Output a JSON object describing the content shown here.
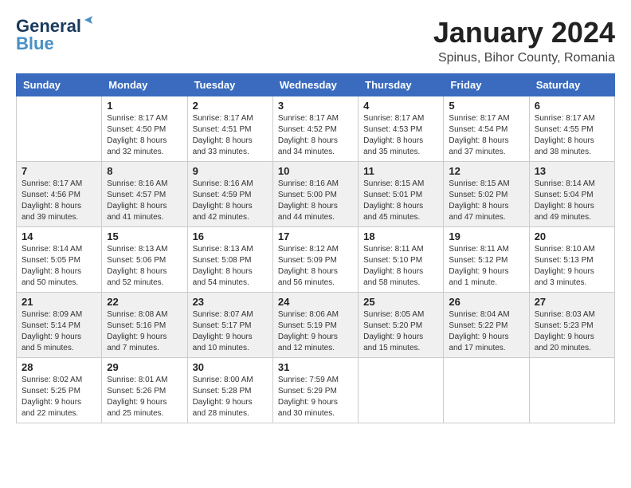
{
  "logo": {
    "line1": "General",
    "line2": "Blue",
    "bird_symbol": "▶"
  },
  "title": "January 2024",
  "location": "Spinus, Bihor County, Romania",
  "days_of_week": [
    "Sunday",
    "Monday",
    "Tuesday",
    "Wednesday",
    "Thursday",
    "Friday",
    "Saturday"
  ],
  "weeks": [
    [
      {
        "day": "",
        "sunrise": "",
        "sunset": "",
        "daylight": ""
      },
      {
        "day": "1",
        "sunrise": "Sunrise: 8:17 AM",
        "sunset": "Sunset: 4:50 PM",
        "daylight": "Daylight: 8 hours and 32 minutes."
      },
      {
        "day": "2",
        "sunrise": "Sunrise: 8:17 AM",
        "sunset": "Sunset: 4:51 PM",
        "daylight": "Daylight: 8 hours and 33 minutes."
      },
      {
        "day": "3",
        "sunrise": "Sunrise: 8:17 AM",
        "sunset": "Sunset: 4:52 PM",
        "daylight": "Daylight: 8 hours and 34 minutes."
      },
      {
        "day": "4",
        "sunrise": "Sunrise: 8:17 AM",
        "sunset": "Sunset: 4:53 PM",
        "daylight": "Daylight: 8 hours and 35 minutes."
      },
      {
        "day": "5",
        "sunrise": "Sunrise: 8:17 AM",
        "sunset": "Sunset: 4:54 PM",
        "daylight": "Daylight: 8 hours and 37 minutes."
      },
      {
        "day": "6",
        "sunrise": "Sunrise: 8:17 AM",
        "sunset": "Sunset: 4:55 PM",
        "daylight": "Daylight: 8 hours and 38 minutes."
      }
    ],
    [
      {
        "day": "7",
        "sunrise": "Sunrise: 8:17 AM",
        "sunset": "Sunset: 4:56 PM",
        "daylight": "Daylight: 8 hours and 39 minutes."
      },
      {
        "day": "8",
        "sunrise": "Sunrise: 8:16 AM",
        "sunset": "Sunset: 4:57 PM",
        "daylight": "Daylight: 8 hours and 41 minutes."
      },
      {
        "day": "9",
        "sunrise": "Sunrise: 8:16 AM",
        "sunset": "Sunset: 4:59 PM",
        "daylight": "Daylight: 8 hours and 42 minutes."
      },
      {
        "day": "10",
        "sunrise": "Sunrise: 8:16 AM",
        "sunset": "Sunset: 5:00 PM",
        "daylight": "Daylight: 8 hours and 44 minutes."
      },
      {
        "day": "11",
        "sunrise": "Sunrise: 8:15 AM",
        "sunset": "Sunset: 5:01 PM",
        "daylight": "Daylight: 8 hours and 45 minutes."
      },
      {
        "day": "12",
        "sunrise": "Sunrise: 8:15 AM",
        "sunset": "Sunset: 5:02 PM",
        "daylight": "Daylight: 8 hours and 47 minutes."
      },
      {
        "day": "13",
        "sunrise": "Sunrise: 8:14 AM",
        "sunset": "Sunset: 5:04 PM",
        "daylight": "Daylight: 8 hours and 49 minutes."
      }
    ],
    [
      {
        "day": "14",
        "sunrise": "Sunrise: 8:14 AM",
        "sunset": "Sunset: 5:05 PM",
        "daylight": "Daylight: 8 hours and 50 minutes."
      },
      {
        "day": "15",
        "sunrise": "Sunrise: 8:13 AM",
        "sunset": "Sunset: 5:06 PM",
        "daylight": "Daylight: 8 hours and 52 minutes."
      },
      {
        "day": "16",
        "sunrise": "Sunrise: 8:13 AM",
        "sunset": "Sunset: 5:08 PM",
        "daylight": "Daylight: 8 hours and 54 minutes."
      },
      {
        "day": "17",
        "sunrise": "Sunrise: 8:12 AM",
        "sunset": "Sunset: 5:09 PM",
        "daylight": "Daylight: 8 hours and 56 minutes."
      },
      {
        "day": "18",
        "sunrise": "Sunrise: 8:11 AM",
        "sunset": "Sunset: 5:10 PM",
        "daylight": "Daylight: 8 hours and 58 minutes."
      },
      {
        "day": "19",
        "sunrise": "Sunrise: 8:11 AM",
        "sunset": "Sunset: 5:12 PM",
        "daylight": "Daylight: 9 hours and 1 minute."
      },
      {
        "day": "20",
        "sunrise": "Sunrise: 8:10 AM",
        "sunset": "Sunset: 5:13 PM",
        "daylight": "Daylight: 9 hours and 3 minutes."
      }
    ],
    [
      {
        "day": "21",
        "sunrise": "Sunrise: 8:09 AM",
        "sunset": "Sunset: 5:14 PM",
        "daylight": "Daylight: 9 hours and 5 minutes."
      },
      {
        "day": "22",
        "sunrise": "Sunrise: 8:08 AM",
        "sunset": "Sunset: 5:16 PM",
        "daylight": "Daylight: 9 hours and 7 minutes."
      },
      {
        "day": "23",
        "sunrise": "Sunrise: 8:07 AM",
        "sunset": "Sunset: 5:17 PM",
        "daylight": "Daylight: 9 hours and 10 minutes."
      },
      {
        "day": "24",
        "sunrise": "Sunrise: 8:06 AM",
        "sunset": "Sunset: 5:19 PM",
        "daylight": "Daylight: 9 hours and 12 minutes."
      },
      {
        "day": "25",
        "sunrise": "Sunrise: 8:05 AM",
        "sunset": "Sunset: 5:20 PM",
        "daylight": "Daylight: 9 hours and 15 minutes."
      },
      {
        "day": "26",
        "sunrise": "Sunrise: 8:04 AM",
        "sunset": "Sunset: 5:22 PM",
        "daylight": "Daylight: 9 hours and 17 minutes."
      },
      {
        "day": "27",
        "sunrise": "Sunrise: 8:03 AM",
        "sunset": "Sunset: 5:23 PM",
        "daylight": "Daylight: 9 hours and 20 minutes."
      }
    ],
    [
      {
        "day": "28",
        "sunrise": "Sunrise: 8:02 AM",
        "sunset": "Sunset: 5:25 PM",
        "daylight": "Daylight: 9 hours and 22 minutes."
      },
      {
        "day": "29",
        "sunrise": "Sunrise: 8:01 AM",
        "sunset": "Sunset: 5:26 PM",
        "daylight": "Daylight: 9 hours and 25 minutes."
      },
      {
        "day": "30",
        "sunrise": "Sunrise: 8:00 AM",
        "sunset": "Sunset: 5:28 PM",
        "daylight": "Daylight: 9 hours and 28 minutes."
      },
      {
        "day": "31",
        "sunrise": "Sunrise: 7:59 AM",
        "sunset": "Sunset: 5:29 PM",
        "daylight": "Daylight: 9 hours and 30 minutes."
      },
      {
        "day": "",
        "sunrise": "",
        "sunset": "",
        "daylight": ""
      },
      {
        "day": "",
        "sunrise": "",
        "sunset": "",
        "daylight": ""
      },
      {
        "day": "",
        "sunrise": "",
        "sunset": "",
        "daylight": ""
      }
    ]
  ]
}
